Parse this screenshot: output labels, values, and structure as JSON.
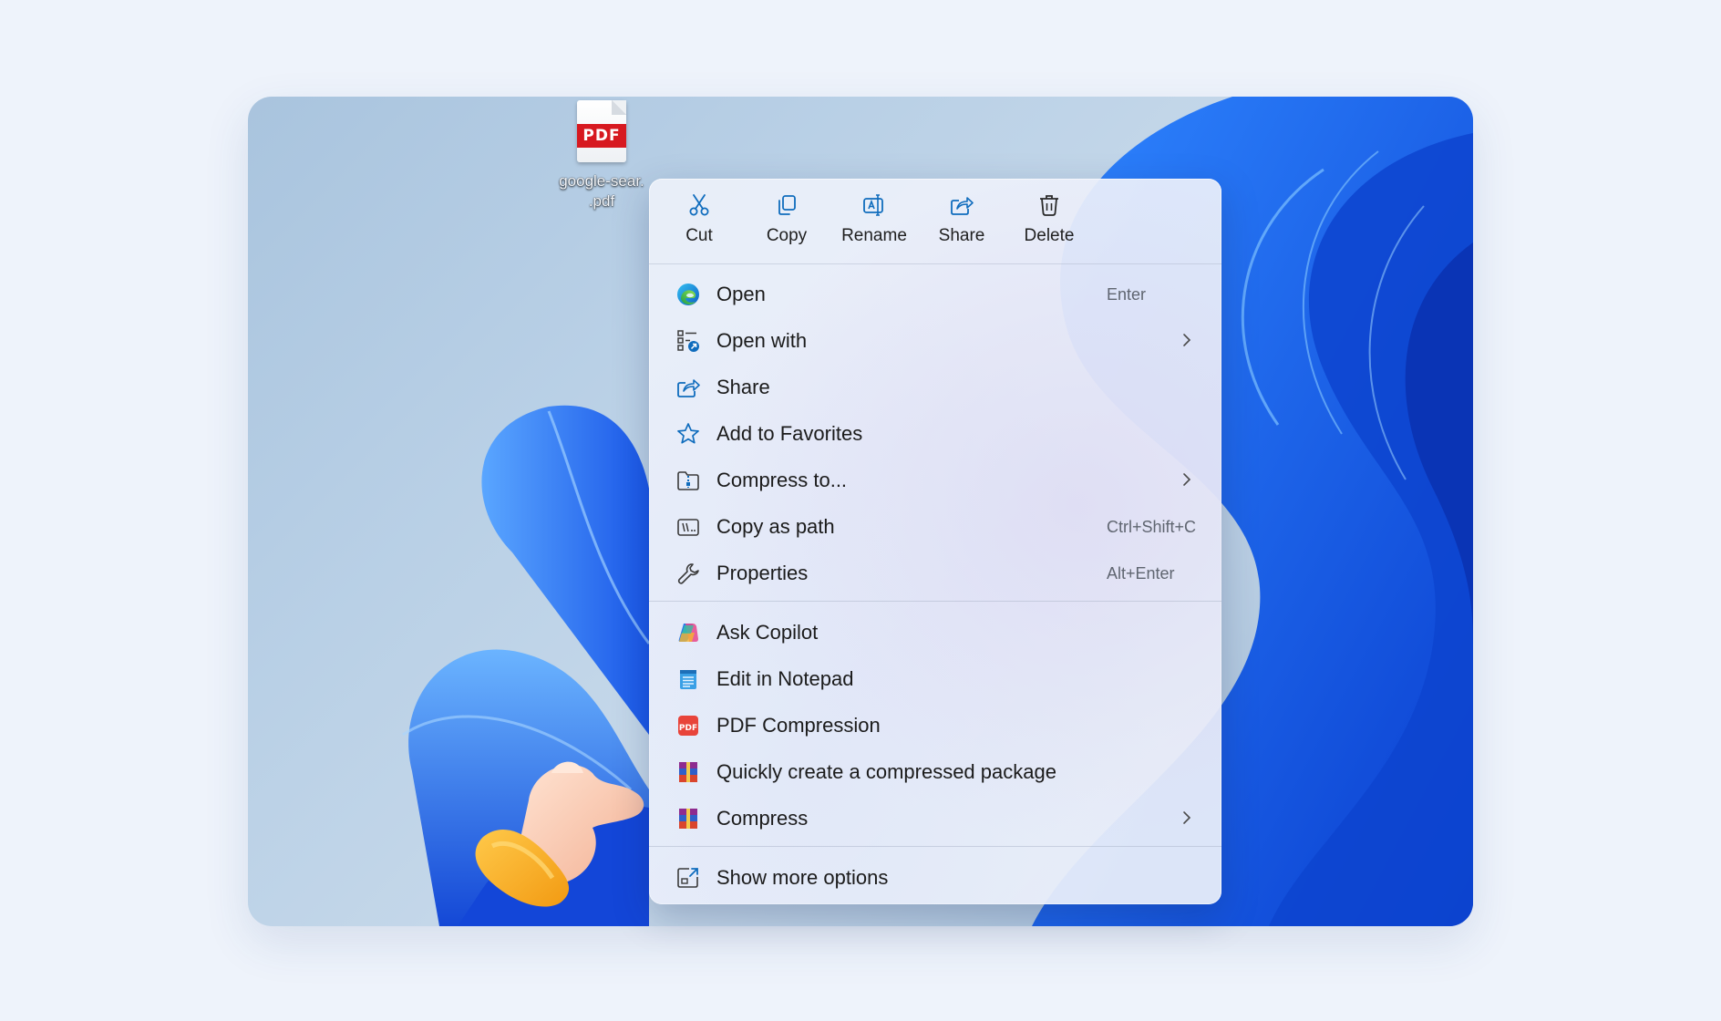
{
  "desktop": {
    "file_icon_tag": "PDF",
    "file_name_line1": "google-sear.",
    "file_name_line2": ".pdf"
  },
  "context_menu": {
    "quick_actions": [
      {
        "label": "Cut",
        "icon": "scissors-icon"
      },
      {
        "label": "Copy",
        "icon": "copy-icon"
      },
      {
        "label": "Rename",
        "icon": "rename-icon"
      },
      {
        "label": "Share",
        "icon": "share-icon"
      },
      {
        "label": "Delete",
        "icon": "trash-icon"
      }
    ],
    "items": [
      {
        "label": "Open",
        "shortcut": "Enter",
        "icon": "edge-icon"
      },
      {
        "label": "Open with",
        "submenu": true,
        "icon": "open-with-icon"
      },
      {
        "label": "Share",
        "icon": "share-icon"
      },
      {
        "label": "Add to Favorites",
        "icon": "star-icon"
      },
      {
        "label": "Compress to...",
        "submenu": true,
        "icon": "zip-folder-icon"
      },
      {
        "label": "Copy as path",
        "shortcut": "Ctrl+Shift+C",
        "icon": "path-icon"
      },
      {
        "label": "Properties",
        "shortcut": "Alt+Enter",
        "icon": "wrench-icon"
      },
      {
        "label": "Ask Copilot",
        "icon": "copilot-icon"
      },
      {
        "label": "Edit in Notepad",
        "icon": "notepad-icon"
      },
      {
        "label": "PDF Compression",
        "icon": "pdf-compression-icon"
      },
      {
        "label": "Quickly create a compressed package",
        "icon": "winrar-icon"
      },
      {
        "label": "Compress",
        "submenu": true,
        "icon": "winrar-icon"
      },
      {
        "label": "Show more options",
        "icon": "more-options-icon"
      }
    ]
  },
  "colors": {
    "accent": "#0f6cbd",
    "pdf_red": "#d71920",
    "wallpaper_blue": "#1f6df2"
  }
}
